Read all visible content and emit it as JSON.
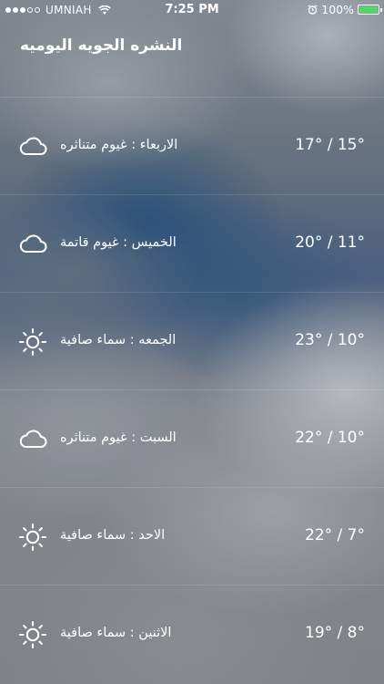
{
  "status_bar": {
    "carrier": "UMNIAH",
    "time": "7:25 PM",
    "battery_percent": "100%",
    "signal_bars_filled": 3,
    "signal_bars_total": 5
  },
  "header": {
    "title": "النشره الجويه اليوميه"
  },
  "forecast": [
    {
      "description": "الاربعاء : غيوم متناثره",
      "temp": "17° / 15°",
      "icon": "cloud-icon"
    },
    {
      "description": "الخميس : غيوم قاتمة",
      "temp": "20° / 11°",
      "icon": "cloud-icon"
    },
    {
      "description": "الجمعه : سماء صافية",
      "temp": "23° / 10°",
      "icon": "sun-icon"
    },
    {
      "description": "السبت : غيوم متناثره",
      "temp": "22° / 10°",
      "icon": "cloud-icon"
    },
    {
      "description": "الاحد : سماء صافية",
      "temp": "22° / 7°",
      "icon": "sun-icon"
    },
    {
      "description": "الاثنين : سماء صافية",
      "temp": "19° / 8°",
      "icon": "sun-icon"
    }
  ],
  "colors": {
    "battery": "#4cd964",
    "text": "#ffffff"
  }
}
